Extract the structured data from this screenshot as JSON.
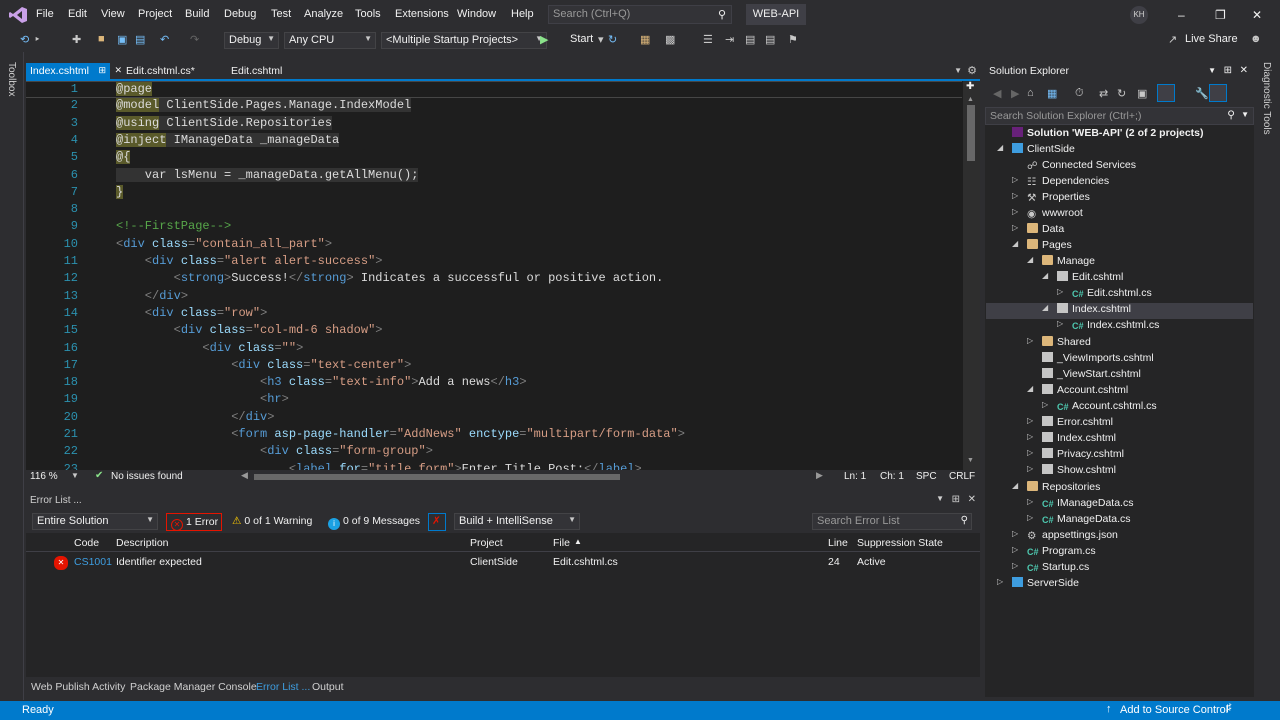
{
  "menu": {
    "items": [
      "File",
      "Edit",
      "View",
      "Project",
      "Build",
      "Debug",
      "Test",
      "Analyze",
      "Tools",
      "Extensions",
      "Window",
      "Help"
    ],
    "search_placeholder": "Search (Ctrl+Q)",
    "solution_name": "WEB-API",
    "avatar_initials": "KH"
  },
  "toolbar": {
    "config": "Debug",
    "platform": "Any CPU",
    "startup": "<Multiple Startup Projects>",
    "start_label": "Start",
    "live_share": "Live Share"
  },
  "side": {
    "toolbox": "Toolbox",
    "diagnostic": "Diagnostic Tools"
  },
  "tabs": [
    {
      "label": "Index.cshtml",
      "active": true
    },
    {
      "label": "Edit.cshtml.cs*"
    },
    {
      "label": "Edit.cshtml"
    }
  ],
  "code_lines": [
    {
      "n": "1"
    },
    {
      "n": "2"
    },
    {
      "n": "3"
    },
    {
      "n": "4"
    },
    {
      "n": "5"
    },
    {
      "n": "6"
    },
    {
      "n": "7"
    },
    {
      "n": "8"
    },
    {
      "n": "9"
    },
    {
      "n": "10"
    },
    {
      "n": "11"
    },
    {
      "n": "12"
    },
    {
      "n": "13"
    },
    {
      "n": "14"
    },
    {
      "n": "15"
    },
    {
      "n": "16"
    },
    {
      "n": "17"
    },
    {
      "n": "18"
    },
    {
      "n": "19"
    },
    {
      "n": "20"
    },
    {
      "n": "21"
    },
    {
      "n": "22"
    },
    {
      "n": "23"
    }
  ],
  "code": {
    "l1": "@page",
    "l2a": "@model",
    "l2b": " ClientSide.Pages.Manage.IndexModel",
    "l3a": "@using",
    "l3b": " ClientSide.Repositories",
    "l4a": "@inject",
    "l4b": " IManageData",
    "l4c": " _manageData",
    "l5": "@{",
    "l6": "    var lsMenu = _manageData.getAllMenu();",
    "l7": "}",
    "l9": "<!--FirstPage-->",
    "l10a": "<",
    "l10b": "div",
    "l10c": " class",
    "l10d": "=",
    "l10e": "\"contain_all_part\"",
    "l10f": ">",
    "l11a": "    <",
    "l11b": "div",
    "l11c": " class",
    "l11d": "=",
    "l11e": "\"alert alert-success\"",
    "l11f": ">",
    "l12a": "        <",
    "l12b": "strong",
    "l12c": ">",
    "l12d": "Success!",
    "l12e": "</",
    "l12f": "strong",
    "l12g": ">",
    "l12h": " Indicates a successful or positive action.",
    "l13a": "    </",
    "l13b": "div",
    "l13c": ">",
    "l14a": "    <",
    "l14b": "div",
    "l14c": " class",
    "l14d": "=",
    "l14e": "\"row\"",
    "l14f": ">",
    "l15a": "        <",
    "l15b": "div",
    "l15c": " class",
    "l15d": "=",
    "l15e": "\"col-md-6 shadow\"",
    "l15f": ">",
    "l16a": "            <",
    "l16b": "div",
    "l16c": " class",
    "l16d": "=",
    "l16e": "\"\"",
    "l16f": ">",
    "l17a": "                <",
    "l17b": "div",
    "l17c": " class",
    "l17d": "=",
    "l17e": "\"text-center\"",
    "l17f": ">",
    "l18a": "                    <",
    "l18b": "h3",
    "l18c": " class",
    "l18d": "=",
    "l18e": "\"text-info\"",
    "l18f": ">",
    "l18g": "Add a news",
    "l18h": "</",
    "l18i": "h3",
    "l18j": ">",
    "l19a": "                    <",
    "l19b": "hr",
    "l19c": ">",
    "l20a": "                </",
    "l20b": "div",
    "l20c": ">",
    "l21a": "                <",
    "l21b": "form",
    "l21c": " asp-page-handler",
    "l21d": "=",
    "l21e": "\"AddNews\"",
    "l21f": " enctype",
    "l21g": "=",
    "l21h": "\"multipart/form-data\"",
    "l21i": ">",
    "l22a": "                    <",
    "l22b": "div",
    "l22c": " class",
    "l22d": "=",
    "l22e": "\"form-group\"",
    "l22f": ">",
    "l23a": "                        <",
    "l23b": "label",
    "l23c": " for",
    "l23d": "=",
    "l23e": "\"title_form\"",
    "l23f": ">",
    "l23g": "Enter Title Post:",
    "l23h": "</",
    "l23i": "label",
    "l23j": ">"
  },
  "editor_status": {
    "zoom": "116 %",
    "issues": "No issues found",
    "ln": "Ln: 1",
    "ch": "Ch: 1",
    "spc": "SPC",
    "crlf": "CRLF"
  },
  "error_list": {
    "title": "Error List ...",
    "scope": "Entire Solution",
    "errors": "1 Error",
    "warnings": "0 of 1 Warning",
    "messages": "0 of 9 Messages",
    "build": "Build + IntelliSense",
    "search_placeholder": "Search Error List",
    "headers": {
      "code": "Code",
      "description": "Description",
      "project": "Project",
      "file": "File",
      "line": "Line",
      "suppression": "Suppression State"
    },
    "row": {
      "code": "CS1001",
      "description": "Identifier expected",
      "project": "ClientSide",
      "file": "Edit.cshtml.cs",
      "line": "24",
      "suppression": "Active"
    }
  },
  "bottom_tabs": [
    "Web Publish Activity",
    "Package Manager Console",
    "Error List ...",
    "Output"
  ],
  "solution_explorer": {
    "title": "Solution Explorer",
    "search_placeholder": "Search Solution Explorer (Ctrl+;)",
    "nodes": [
      "Solution 'WEB-API' (2 of 2 projects)",
      "ClientSide",
      "Connected Services",
      "Dependencies",
      "Properties",
      "wwwroot",
      "Data",
      "Pages",
      "Manage",
      "Edit.cshtml",
      "Edit.cshtml.cs",
      "Index.cshtml",
      "Index.cshtml.cs",
      "Shared",
      "_ViewImports.cshtml",
      "_ViewStart.cshtml",
      "Account.cshtml",
      "Account.cshtml.cs",
      "Error.cshtml",
      "Index.cshtml",
      "Privacy.cshtml",
      "Show.cshtml",
      "Repositories",
      "IManageData.cs",
      "ManageData.cs",
      "appsettings.json",
      "Program.cs",
      "Startup.cs",
      "ServerSide"
    ]
  },
  "status": {
    "ready": "Ready",
    "source_control": "Add to Source Control"
  },
  "colors": {
    "accent": "#007acc",
    "error": "#e51400"
  }
}
